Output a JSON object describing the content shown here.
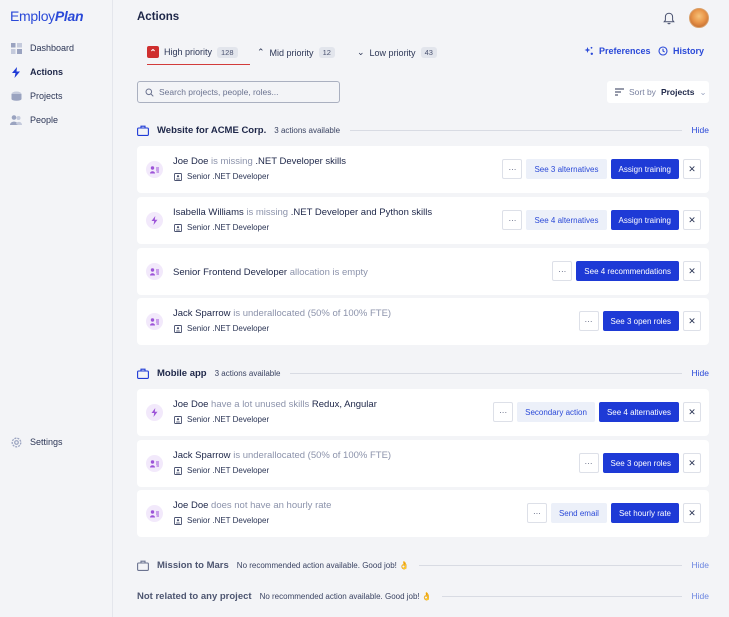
{
  "logo": {
    "part1": "Employ",
    "part2": "Plan"
  },
  "sidebar": {
    "items": [
      {
        "label": "Dashboard",
        "icon": "dashboard-icon"
      },
      {
        "label": "Actions",
        "icon": "lightning-icon"
      },
      {
        "label": "Projects",
        "icon": "projects-icon"
      },
      {
        "label": "People",
        "icon": "people-icon"
      }
    ],
    "settings": "Settings"
  },
  "header": {
    "title": "Actions"
  },
  "tabs": [
    {
      "label": "High priority",
      "count": "128"
    },
    {
      "label": "Mid priority",
      "count": "12"
    },
    {
      "label": "Low priority",
      "count": "43"
    }
  ],
  "links": {
    "preferences": "Preferences",
    "history": "History"
  },
  "search": {
    "placeholder": "Search projects, people, roles..."
  },
  "sort": {
    "label": "Sort by",
    "value": "Projects"
  },
  "groups": [
    {
      "name": "Website for ACME Corp.",
      "sub": "3 actions available",
      "hide": "Hide",
      "cards": [
        {
          "who": "Joe Doe",
          "mid": " is missing ",
          "what": ".NET Developer skills",
          "role": "Senior .NET Developer",
          "secondary": "See 3 alternatives",
          "primary": "Assign training"
        },
        {
          "who": "Isabella Williams",
          "mid": " is missing ",
          "what": ".NET Developer and Python skills",
          "role": "Senior .NET Developer",
          "secondary": "See 4 alternatives",
          "primary": "Assign training"
        },
        {
          "who": "Senior Frontend Developer",
          "mid": " allocation is empty",
          "primary": "See 4 recommendations"
        },
        {
          "who": "Jack Sparrow",
          "mid": " is underallocated (50% of 100% FTE)",
          "role": "Senior .NET Developer",
          "primary": "See 3 open roles"
        }
      ]
    },
    {
      "name": "Mobile app",
      "sub": "3 actions available",
      "hide": "Hide",
      "cards": [
        {
          "who": "Joe Doe",
          "mid": " have a lot unused skills ",
          "what": "Redux, Angular",
          "role": "Senior .NET Developer",
          "secondary": "Secondary action",
          "primary": "See 4 alternatives"
        },
        {
          "who": "Jack Sparrow",
          "mid": " is underallocated (50% of 100% FTE)",
          "role": "Senior .NET Developer",
          "primary": "See 3 open roles"
        },
        {
          "who": "Joe Doe",
          "mid": " does not have an hourly rate",
          "role": "Senior .NET Developer",
          "secondary": "Send email",
          "primary": "Set hourly rate"
        }
      ]
    },
    {
      "name": "Mission to Mars",
      "sub": "No recommended action available. Good job! 👌",
      "hide": "Hide"
    },
    {
      "name": "Not related to any project",
      "sub": "No recommended action available. Good job! 👌",
      "hide": "Hide"
    }
  ],
  "colors": {
    "accent": "#1e3ad6",
    "priority_high": "#cf2f2f",
    "icon_purple": "#9d54d8"
  }
}
